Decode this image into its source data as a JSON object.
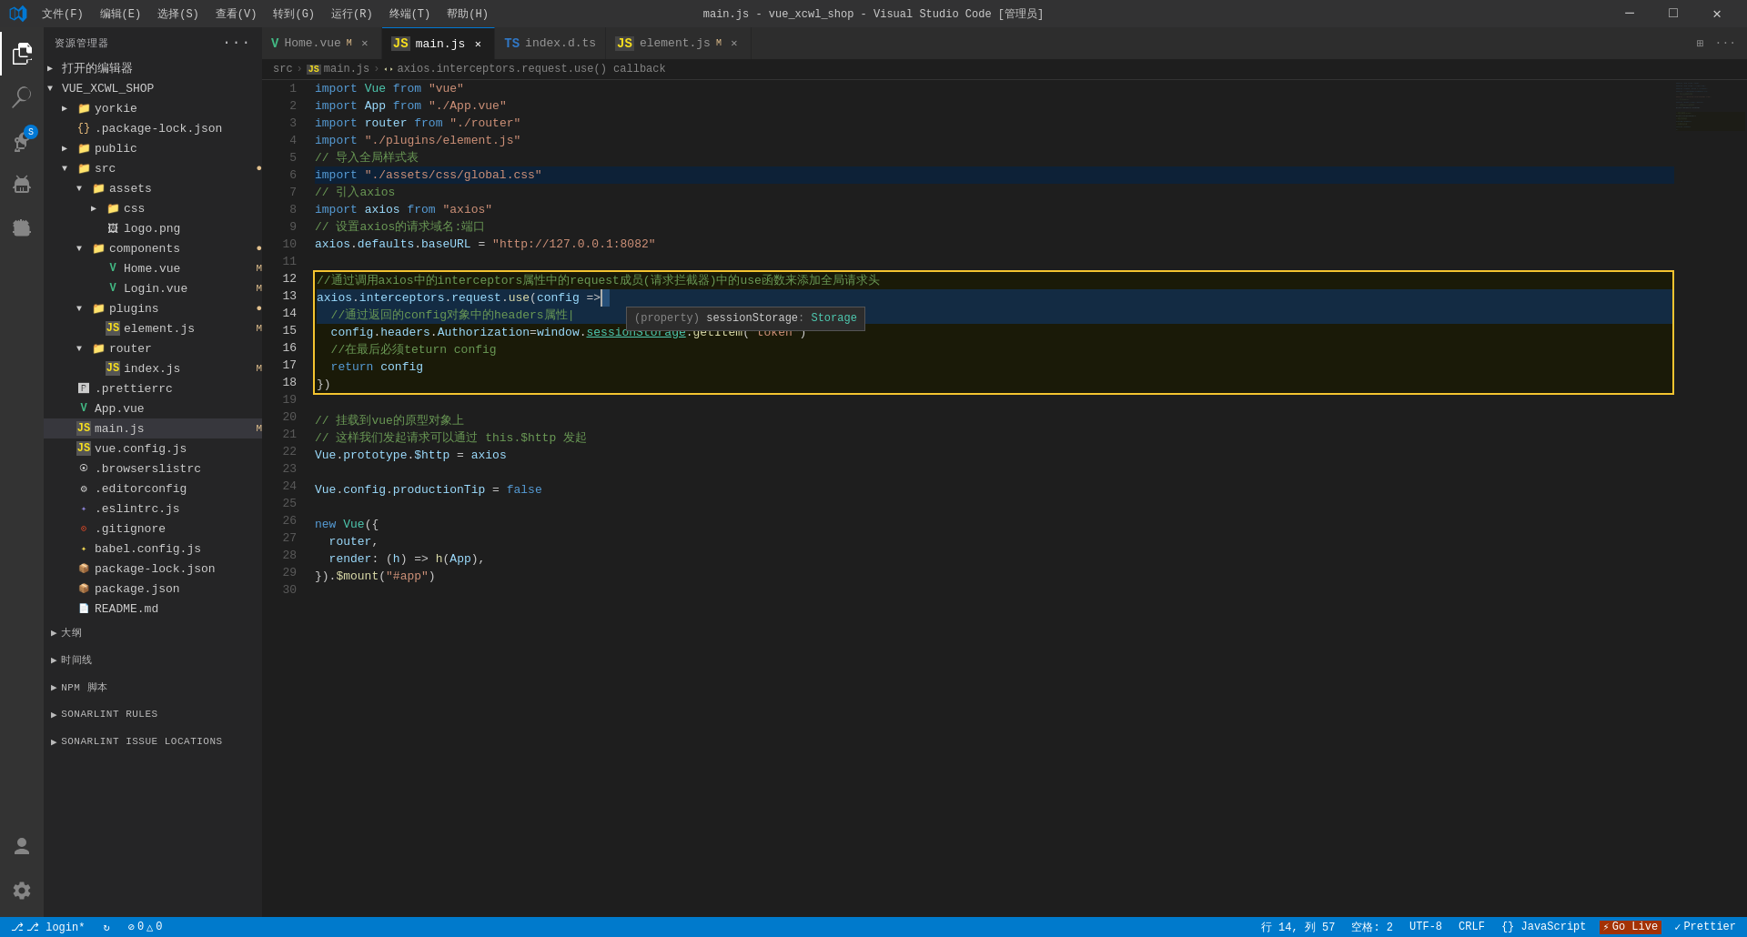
{
  "titlebar": {
    "title": "main.js - vue_xcwl_shop - Visual Studio Code [管理员]",
    "menu": [
      "文件(F)",
      "编辑(E)",
      "选择(S)",
      "查看(V)",
      "转到(G)",
      "运行(R)",
      "终端(T)",
      "帮助(H)"
    ],
    "buttons": [
      "─",
      "□",
      "✕"
    ]
  },
  "tabs": [
    {
      "id": "home-vue",
      "lang": "vue",
      "label": "Home.vue",
      "modified": true,
      "active": false,
      "closeable": true
    },
    {
      "id": "main-js",
      "lang": "js",
      "label": "main.js",
      "modified": false,
      "active": true,
      "closeable": true
    },
    {
      "id": "index-dts",
      "lang": "ts",
      "label": "index.d.ts",
      "modified": false,
      "active": false,
      "closeable": false
    },
    {
      "id": "element-js",
      "lang": "js",
      "label": "element.js",
      "modified": true,
      "active": false,
      "closeable": true
    }
  ],
  "breadcrumb": {
    "parts": [
      "src",
      "JS main.js",
      "axios.interceptors.request.use() callback"
    ]
  },
  "sidebar": {
    "title": "资源管理器",
    "explorer_label": "打开的编辑器",
    "project_name": "VUE_XCWL_SHOP",
    "tree": [
      {
        "level": 1,
        "type": "folder",
        "label": "yorkie",
        "open": false
      },
      {
        "level": 1,
        "type": "file",
        "label": ".package-lock.json",
        "icon": "{}"
      },
      {
        "level": 1,
        "type": "folder",
        "label": "public",
        "open": false
      },
      {
        "level": 1,
        "type": "folder",
        "label": "src",
        "open": true,
        "modified": true
      },
      {
        "level": 2,
        "type": "folder",
        "label": "assets",
        "open": true
      },
      {
        "level": 3,
        "type": "folder",
        "label": "css",
        "open": false
      },
      {
        "level": 3,
        "type": "file",
        "label": "logo.png"
      },
      {
        "level": 2,
        "type": "folder",
        "label": "components",
        "open": true,
        "modified": true
      },
      {
        "level": 3,
        "type": "file-vue",
        "label": "Home.vue",
        "modified": true
      },
      {
        "level": 3,
        "type": "file-vue",
        "label": "Login.vue",
        "modified": true
      },
      {
        "level": 2,
        "type": "folder",
        "label": "plugins",
        "open": true,
        "modified": true
      },
      {
        "level": 3,
        "type": "file-js",
        "label": "element.js",
        "modified": true
      },
      {
        "level": 2,
        "type": "folder",
        "label": "router",
        "open": true
      },
      {
        "level": 3,
        "type": "file-js",
        "label": "index.js",
        "modified": true
      },
      {
        "level": 1,
        "type": "file",
        "label": ".prettierrc"
      },
      {
        "level": 1,
        "type": "file-vue",
        "label": "App.vue"
      },
      {
        "level": 1,
        "type": "file-js",
        "label": "main.js",
        "modified": true,
        "active": true
      },
      {
        "level": 1,
        "type": "file-js",
        "label": "vue.config.js"
      },
      {
        "level": 1,
        "type": "file",
        "label": ".browserslistrc"
      },
      {
        "level": 1,
        "type": "file",
        "label": ".editorconfig"
      },
      {
        "level": 1,
        "type": "file",
        "label": ".eslintrc.js"
      },
      {
        "level": 1,
        "type": "file",
        "label": ".gitignore"
      },
      {
        "level": 1,
        "type": "file",
        "label": "babel.config.js"
      },
      {
        "level": 1,
        "type": "file",
        "label": "package-lock.json"
      },
      {
        "level": 1,
        "type": "file",
        "label": "package.json"
      },
      {
        "level": 1,
        "type": "file",
        "label": "README.md"
      }
    ],
    "sections": [
      {
        "label": "大纲"
      },
      {
        "label": "时间线"
      },
      {
        "label": "NPM 脚本"
      },
      {
        "label": "SONARLINT RULES"
      },
      {
        "label": "SONARLINT ISSUE LOCATIONS"
      }
    ]
  },
  "code": {
    "lines": [
      {
        "num": 1,
        "text": "import Vue from \"vue\""
      },
      {
        "num": 2,
        "text": "import App from \"./App.vue\""
      },
      {
        "num": 3,
        "text": "import router from \"./router\""
      },
      {
        "num": 4,
        "text": "import \"./plugins/element.js\""
      },
      {
        "num": 5,
        "text": "// 导入全局样式表"
      },
      {
        "num": 6,
        "text": "import \"./assets/css/global.css\""
      },
      {
        "num": 7,
        "text": "// 引入axios"
      },
      {
        "num": 8,
        "text": "import axios from \"axios\""
      },
      {
        "num": 9,
        "text": "// 设置axios的请求域名:端口"
      },
      {
        "num": 10,
        "text": "axios.defaults.baseURL = \"http://127.0.0.1:8082\""
      },
      {
        "num": 11,
        "text": ""
      },
      {
        "num": 12,
        "text": "//通过调用axios中的interceptors属性中的request成员(请求拦截器)中的use函数来添加全局请求头",
        "highlight": true
      },
      {
        "num": 13,
        "text": "axios.interceptors.request.use(config =>|",
        "highlight": true
      },
      {
        "num": 14,
        "text": "  //通过返回的config对象中的headers属性|",
        "highlight": true,
        "tooltip": true
      },
      {
        "num": 15,
        "text": "  config.headers.Authorization=window.sessionStorage.getItem(\"token\")",
        "highlight": true
      },
      {
        "num": 16,
        "text": "  //在最后必须teturn config",
        "highlight": true
      },
      {
        "num": 17,
        "text": "  return config",
        "highlight": true
      },
      {
        "num": 18,
        "text": "})",
        "highlight": true
      },
      {
        "num": 19,
        "text": ""
      },
      {
        "num": 20,
        "text": "// 挂载到vue的原型对象上"
      },
      {
        "num": 21,
        "text": "// 这样我们发起请求可以通过 this.$http 发起"
      },
      {
        "num": 22,
        "text": "Vue.prototype.$http = axios"
      },
      {
        "num": 23,
        "text": ""
      },
      {
        "num": 24,
        "text": "Vue.config.productionTip = false"
      },
      {
        "num": 25,
        "text": ""
      },
      {
        "num": 26,
        "text": "new Vue({"
      },
      {
        "num": 27,
        "text": "  router,"
      },
      {
        "num": 28,
        "text": "  render: (h) => h(App),"
      },
      {
        "num": 29,
        "text": "}).$mount(\"#app\")"
      },
      {
        "num": 30,
        "text": ""
      }
    ]
  },
  "tooltip": {
    "text": "(property) sessionStorage: Storage"
  },
  "statusbar": {
    "left": [
      {
        "label": "⎇ login*"
      },
      {
        "label": "↻"
      },
      {
        "label": "⊘ 0  △ 0"
      }
    ],
    "right": [
      {
        "label": "行 14, 列 57"
      },
      {
        "label": "空格: 2"
      },
      {
        "label": "UTF-8"
      },
      {
        "label": "CRLF"
      },
      {
        "label": "{} JavaScript"
      },
      {
        "label": "Go Live"
      },
      {
        "label": "✓ Prettier"
      }
    ]
  }
}
